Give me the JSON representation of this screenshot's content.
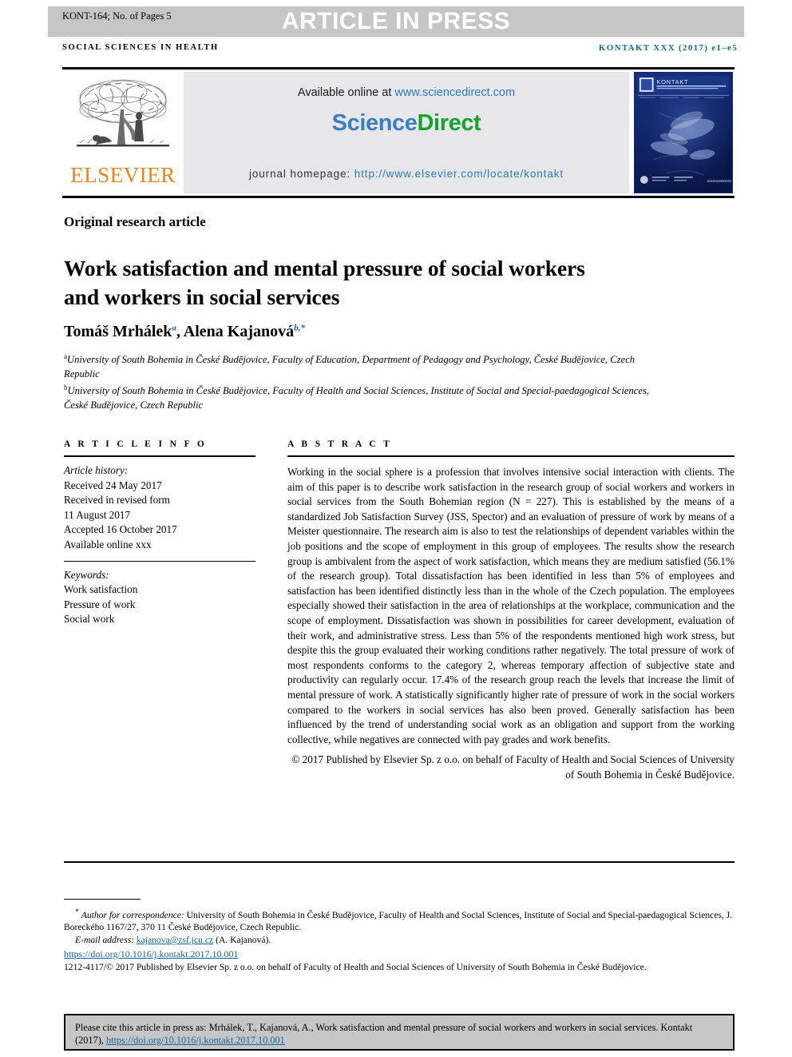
{
  "banner": {
    "article_id": "KONT-164; No. of Pages 5",
    "press_label": "ARTICLE IN PRESS"
  },
  "running_head": {
    "left": "SOCIAL SCIENCES IN HEALTH",
    "right": "KONTAKT XXX (2017) e1–e5"
  },
  "masthead": {
    "publisher_name": "ELSEVIER",
    "available_prefix": "Available online at ",
    "available_url": "www.sciencedirect.com",
    "sciencedirect_science": "Science",
    "sciencedirect_direct": "Direct",
    "homepage_label": "journal homepage: ",
    "homepage_url": "http://www.elsevier.com/locate/kontakt",
    "cover": {
      "journal_title": "KONTAKT",
      "journal_subtitle": "JOURNAL OF NURSING AND SOCIAL SCIENCES RELATED TO HEALTH AND ILLNESS",
      "footer_brand": "ScienceDirect"
    },
    "colors": {
      "elsevier_orange": "#e8861e",
      "sciencedirect_blue": "#3a7fc1",
      "sciencedirect_green": "#16a22d",
      "link_blue": "#2b7bb9",
      "banner_gray": "#c6c6c6",
      "panel_gray": "#e7e7e9",
      "cover_blue": "#0b1f63"
    }
  },
  "article": {
    "type": "Original research article",
    "title": "Work satisfaction and mental pressure of social workers and workers in social services",
    "authors_html": "Tomáš Mrhálek<sup>a</sup>, Alena Kajanová<sup>b,*</sup>",
    "affiliation_a": "University of South Bohemia in České Budějovice, Faculty of Education, Department of Pedagogy and Psychology, České Budějovice, Czech Republic",
    "affiliation_b": "University of South Bohemia in České Budějovice, Faculty of Health and Social Sciences, Institute of Social and Special-paedagogical Sciences, České Budějovice, Czech Republic"
  },
  "article_info": {
    "heading": "A R T I C L E  I N F O",
    "history_label": "Article history:",
    "history_lines": [
      "Received 24 May 2017",
      "Received in revised form",
      "11 August 2017",
      "Accepted 16 October 2017",
      "Available online xxx"
    ],
    "keywords_label": "Keywords:",
    "keywords": [
      "Work satisfaction",
      "Pressure of work",
      "Social work"
    ]
  },
  "abstract": {
    "heading": "A B S T R A C T",
    "body": "Working in the social sphere is a profession that involves intensive social interaction with clients. The aim of this paper is to describe work satisfaction in the research group of social workers and workers in social services from the South Bohemian region (N = 227). This is established by the means of a standardized Job Satisfaction Survey (JSS, Spector) and an evaluation of pressure of work by means of a Meister questionnaire. The research aim is also to test the relationships of dependent variables within the job positions and the scope of employment in this group of employees. The results show the research group is ambivalent from the aspect of work satisfaction, which means they are medium satisfied (56.1% of the research group). Total dissatisfaction has been identified in less than 5% of employees and satisfaction has been identified distinctly less than in the whole of the Czech population. The employees especially showed their satisfaction in the area of relationships at the workplace, communication and the scope of employment. Dissatisfaction was shown in possibilities for career development, evaluation of their work, and administrative stress. Less than 5% of the respondents mentioned high work stress, but despite this the group evaluated their working conditions rather negatively. The total pressure of work of most respondents conforms to the category 2, whereas temporary affection of subjective state and productivity can regularly occur. 17.4% of the research group reach the levels that increase the limit of mental pressure of work. A statistically significantly higher rate of pressure of work in the social workers compared to the workers in social services has also been proved. Generally satisfaction has been influenced by the trend of understanding social work as an obligation and support from the working collective, while negatives are connected with pay grades and work benefits.",
    "copyright": "© 2017 Published by Elsevier Sp. z o.o. on behalf of Faculty of Health and Social Sciences of University of South Bohemia in České Budějovice."
  },
  "footnotes": {
    "correspondence_marker": "*",
    "correspondence_label": "Author for correspondence:",
    "correspondence_text": " University of South Bohemia in České Budějovice, Faculty of Health and Social Sciences, Institute of Social and Special-paedagogical Sciences, J. Boreckého 1167/27, 370 11 České Budějovice, Czech Republic.",
    "email_label": "E-mail address:",
    "email_address": "kajanova@zsf.jcu.cz",
    "email_owner": "(A. Kajanová).",
    "doi": "https://doi.org/10.1016/j.kontakt.2017.10.001",
    "issn_line": "1212-4117/© 2017 Published by Elsevier Sp. z o.o. on behalf of Faculty of Health and Social Sciences of University of South Bohemia in České Budějovice."
  },
  "cite_box": {
    "text": "Please cite this article in press as: Mrhálek, T., Kajanová, A., Work satisfaction and mental pressure of social workers and workers in social services. Kontakt (2017), ",
    "link": "https://doi.org/10.1016/j.kontakt.2017.10.001"
  }
}
